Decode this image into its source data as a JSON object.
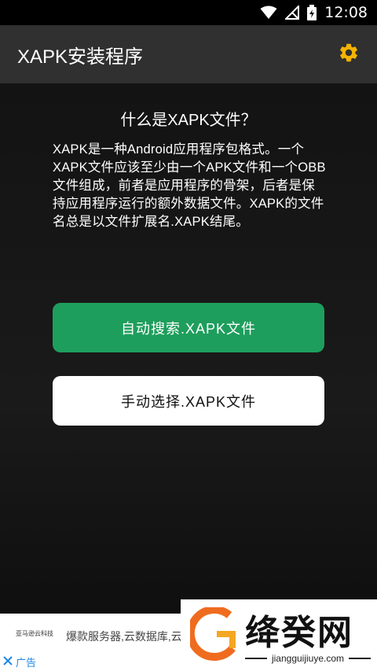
{
  "status_bar": {
    "time": "12:08",
    "icons": [
      "wifi-icon",
      "signal-off-icon",
      "battery-charging-icon"
    ]
  },
  "app_bar": {
    "title": "XAPK安装程序",
    "settings_icon": "gear-icon",
    "accent": "#f5b301"
  },
  "main": {
    "section_title": "什么是XAPK文件？",
    "description": "XAPK是一种Android应用程序包格式。一个XAPK文件应该至少由一个APK文件和一个OBB文件组成，前者是应用程序的骨架，后者是保持应用程序运行的额外数据文件。XAPK的文件名总是以文件扩展名.XAPK结尾。",
    "auto_button_label": "自动搜索.XAPK文件",
    "manual_button_label": "手动选择.XAPK文件",
    "auto_button_color": "#1e9e5c",
    "manual_button_color": "#ffffff"
  },
  "ad": {
    "logo_text": "亚马逊云科技",
    "text": "爆款服务器,云数据库,云亚马逊云产品免费申领",
    "close_label": "广告"
  },
  "watermark": {
    "title": "绛癸网",
    "url": "jiangguijiuye.com"
  }
}
